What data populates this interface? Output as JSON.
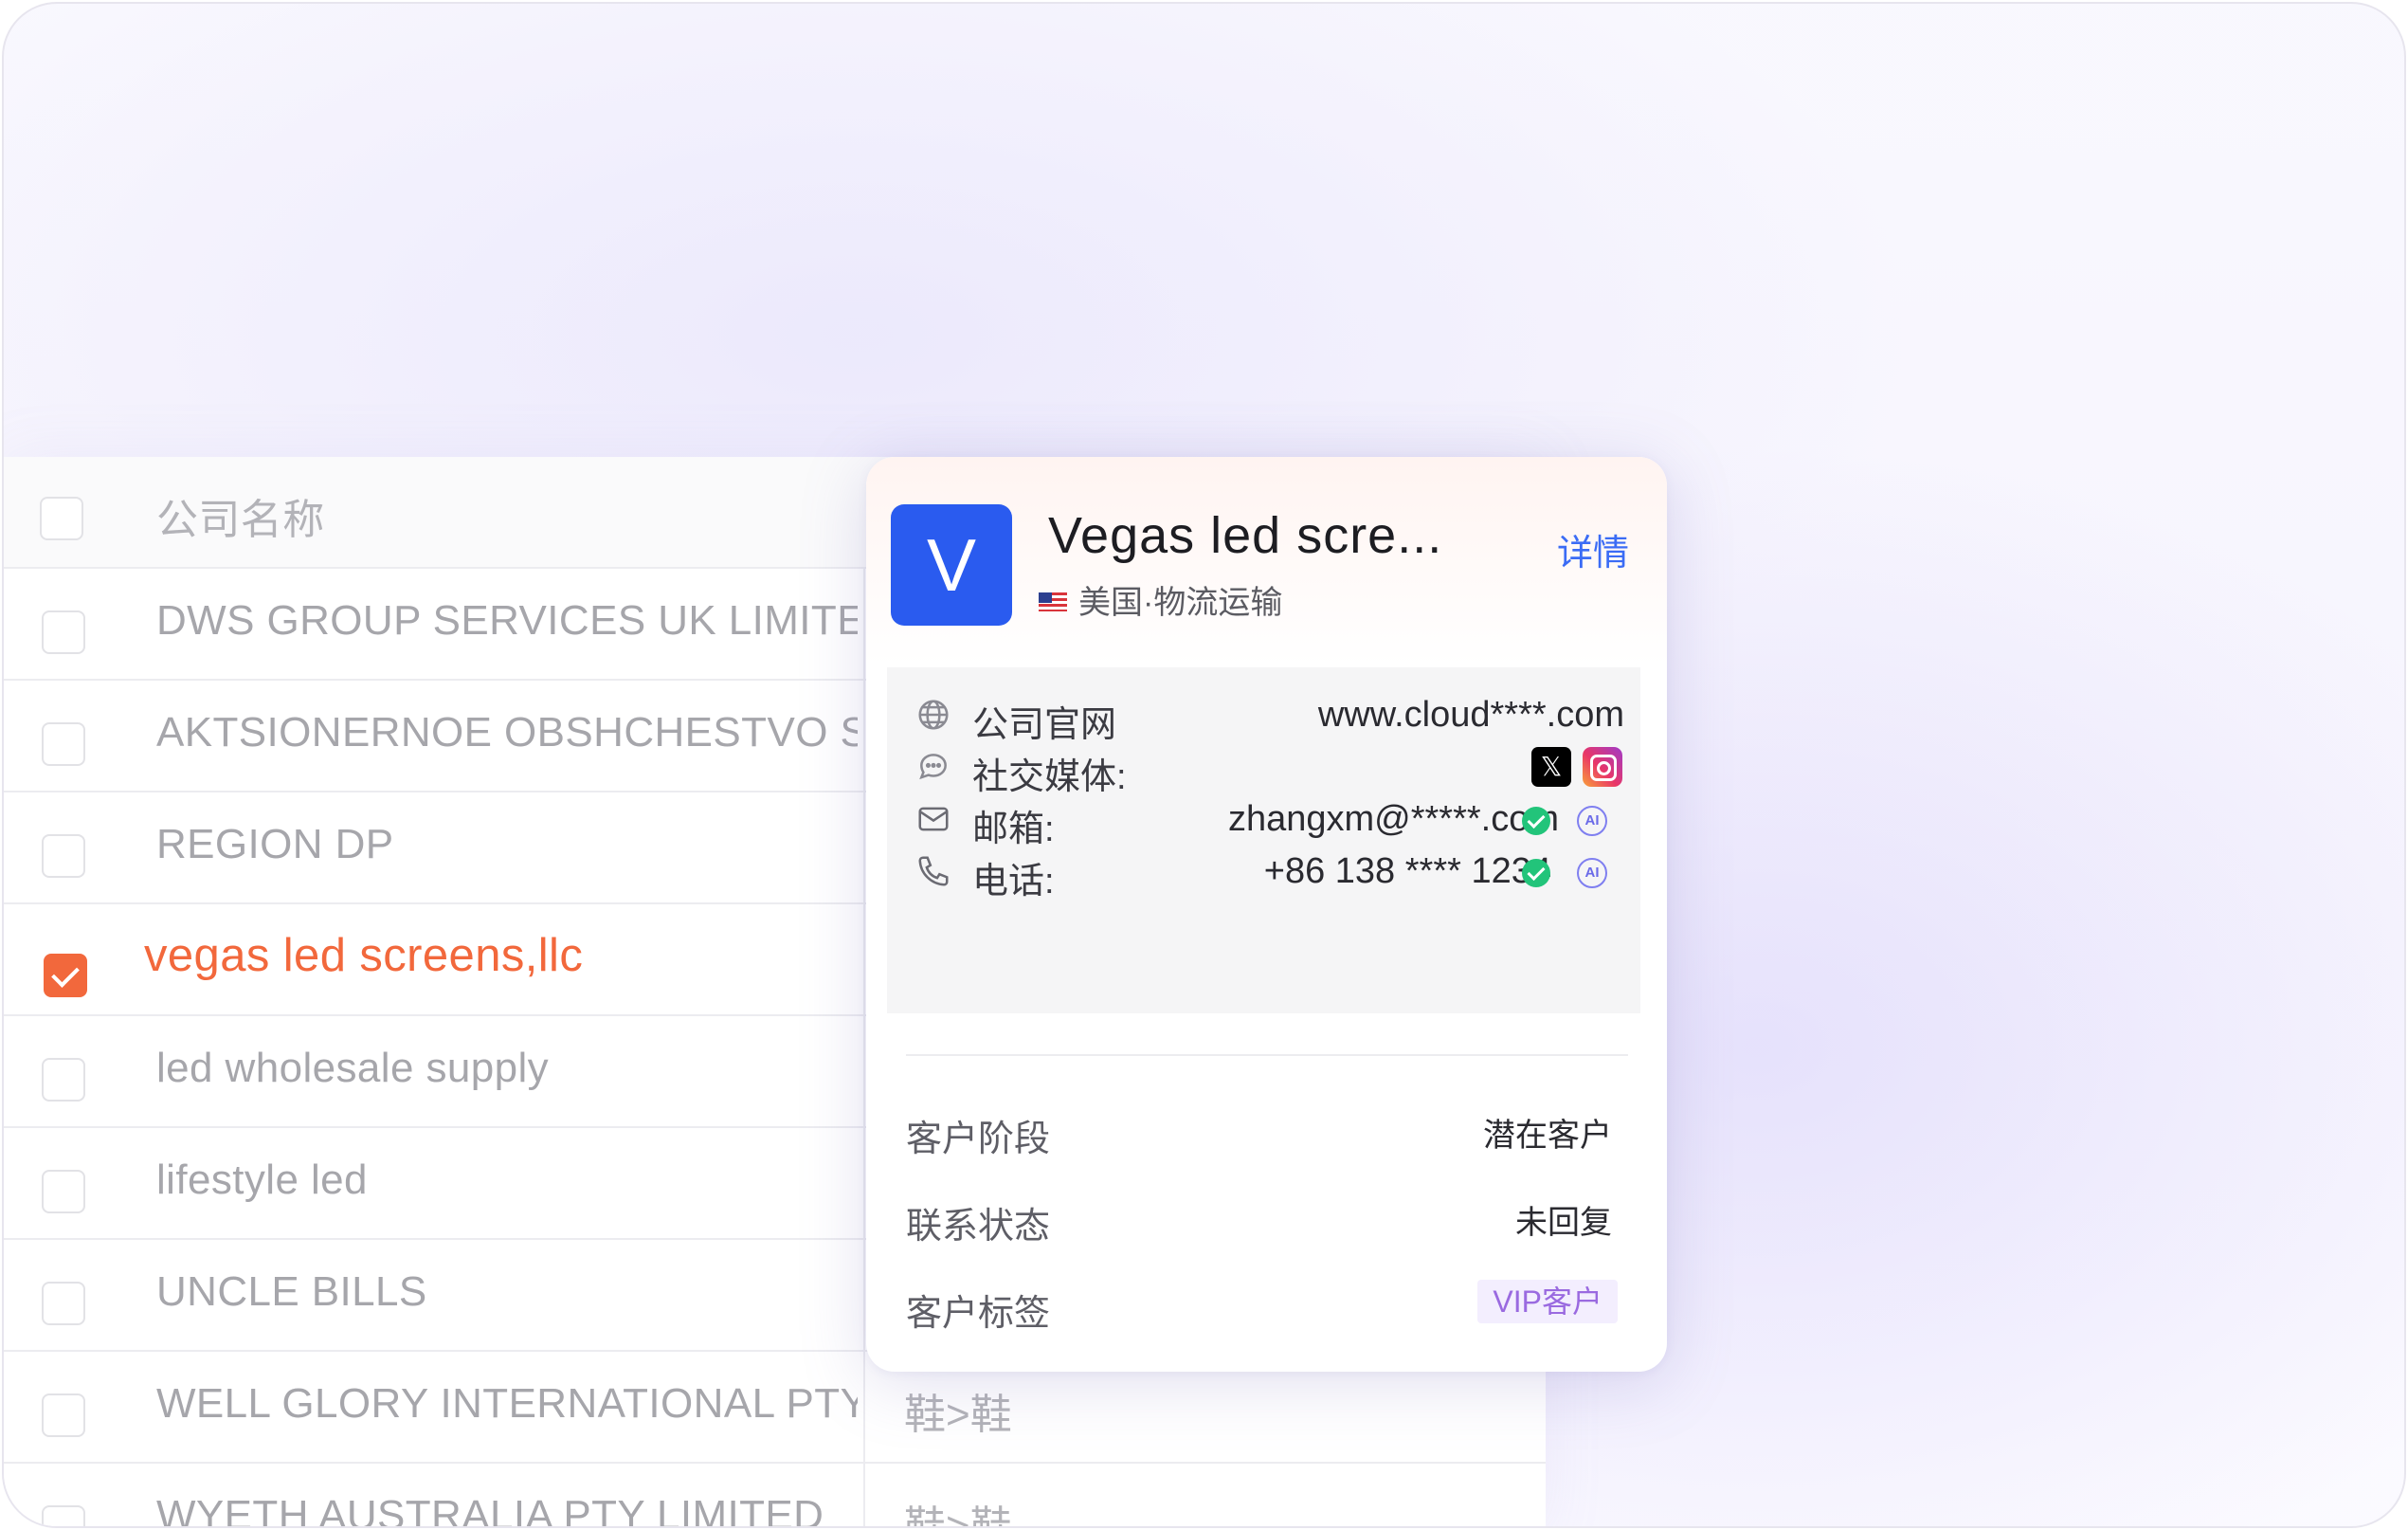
{
  "table": {
    "header": {
      "column_name": "公司名称"
    },
    "rows": [
      {
        "name": "DWS GROUP SERVICES UK LIMITE",
        "industry": "",
        "checked": false
      },
      {
        "name": "AKTSIONERNOE OBSHCHESTVO S",
        "industry": "",
        "checked": false
      },
      {
        "name": "REGION DP",
        "industry": "",
        "checked": false
      },
      {
        "name": "vegas led screens,llc",
        "industry": "",
        "checked": true
      },
      {
        "name": "led wholesale supply",
        "industry": "",
        "checked": false
      },
      {
        "name": "lifestyle led",
        "industry": "",
        "checked": false
      },
      {
        "name": "UNCLE BILLS",
        "industry": "",
        "checked": false
      },
      {
        "name": "WELL GLORY INTERNATIONAL PTY",
        "industry": "鞋>鞋",
        "checked": false
      },
      {
        "name": "WYETH AUSTRALIA PTY LIMITED",
        "industry": "鞋>鞋",
        "checked": false
      }
    ]
  },
  "card": {
    "logo_letter": "V",
    "title": "Vegas led scre...",
    "detail_link": "详情",
    "meta": "美国·物流运输",
    "flag_icon": "us-flag-icon",
    "info": {
      "website_label": "公司官网",
      "website_value": "www.cloud****.com",
      "social_label": "社交媒体:",
      "social_x_glyph": "𝕏",
      "email_label": "邮箱:",
      "email_value": "zhangxm@*****.com",
      "phone_label": "电话:",
      "phone_value": "+86 138 **** 1234",
      "ai_badge": "AI"
    },
    "fields": [
      {
        "label": "客户阶段",
        "value": "潜在客户"
      },
      {
        "label": "联系状态",
        "value": "未回复"
      },
      {
        "label": "客户标签",
        "value": "VIP客户"
      }
    ]
  },
  "colors": {
    "accent_orange": "#f2683c",
    "logo_blue": "#2a5bef",
    "link_blue": "#3b6cf5",
    "verified_green": "#22c47a",
    "vip_purple": "#9a6ae0"
  }
}
